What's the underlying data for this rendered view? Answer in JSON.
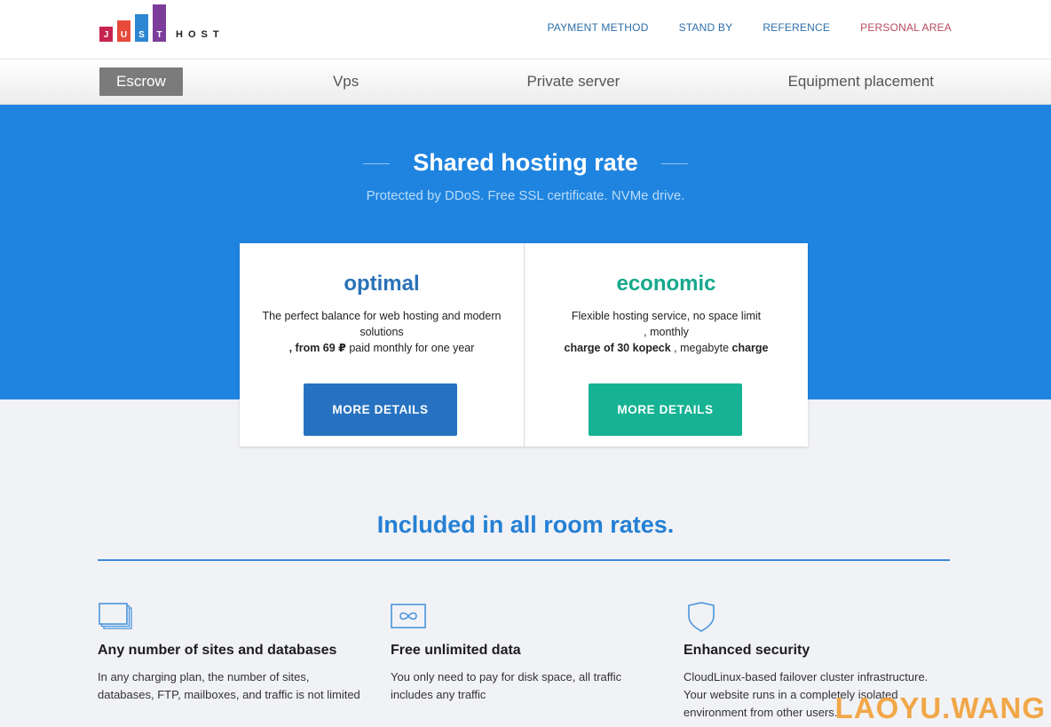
{
  "logo": {
    "letters": [
      "J",
      "U",
      "S",
      "T"
    ],
    "host": "HOST"
  },
  "topnav": {
    "payment": "PAYMENT METHOD",
    "standby": "STAND BY",
    "reference": "REFERENCE",
    "personal": "PERSONAL AREA"
  },
  "subnav": {
    "tabs": [
      "Escrow",
      "Vps",
      "Private server",
      "Equipment placement"
    ]
  },
  "hero": {
    "title": "Shared hosting rate",
    "subtitle": "Protected by DDoS. Free SSL certificate. NVMe drive."
  },
  "plans": {
    "optimal": {
      "name": "optimal",
      "line1": "The perfect balance for web hosting and modern solutions",
      "line2_pre": ", from ",
      "line2_bold": "69 ₽",
      "line2_post": " paid monthly for one year",
      "button": "MORE DETAILS"
    },
    "economic": {
      "name": "economic",
      "line1": "Flexible hosting service, no space limit",
      "line2": ", monthly",
      "line3_bold1": "charge of 30 kopeck",
      "line3_mid": " , megabyte ",
      "line3_bold2": "charge",
      "button": "MORE DETAILS"
    }
  },
  "included": {
    "title": "Included in all room rates.",
    "features": [
      {
        "icon": "windows-stack-icon",
        "title": "Any number of sites and databases",
        "text": "In any charging plan, the number of sites, databases, FTP, mailboxes, and traffic is not limited"
      },
      {
        "icon": "infinity-icon",
        "title": "Free unlimited data",
        "text": "You only need to pay for disk space, all traffic includes any traffic"
      },
      {
        "icon": "shield-icon",
        "title": "Enhanced security",
        "text": "CloudLinux-based failover cluster infrastructure. Your website runs in a completely isolated environment from other users."
      }
    ]
  },
  "watermark": "LAOYU.WANG",
  "colors": {
    "hero_blue": "#1f84e0",
    "optimal_blue": "#2772c0",
    "economic_green": "#16b294",
    "personal_area": "#b84a5e",
    "logo_j": "#c8234f",
    "logo_u": "#e64a3a",
    "logo_s": "#2d86d2",
    "logo_t": "#7d3d9b"
  }
}
